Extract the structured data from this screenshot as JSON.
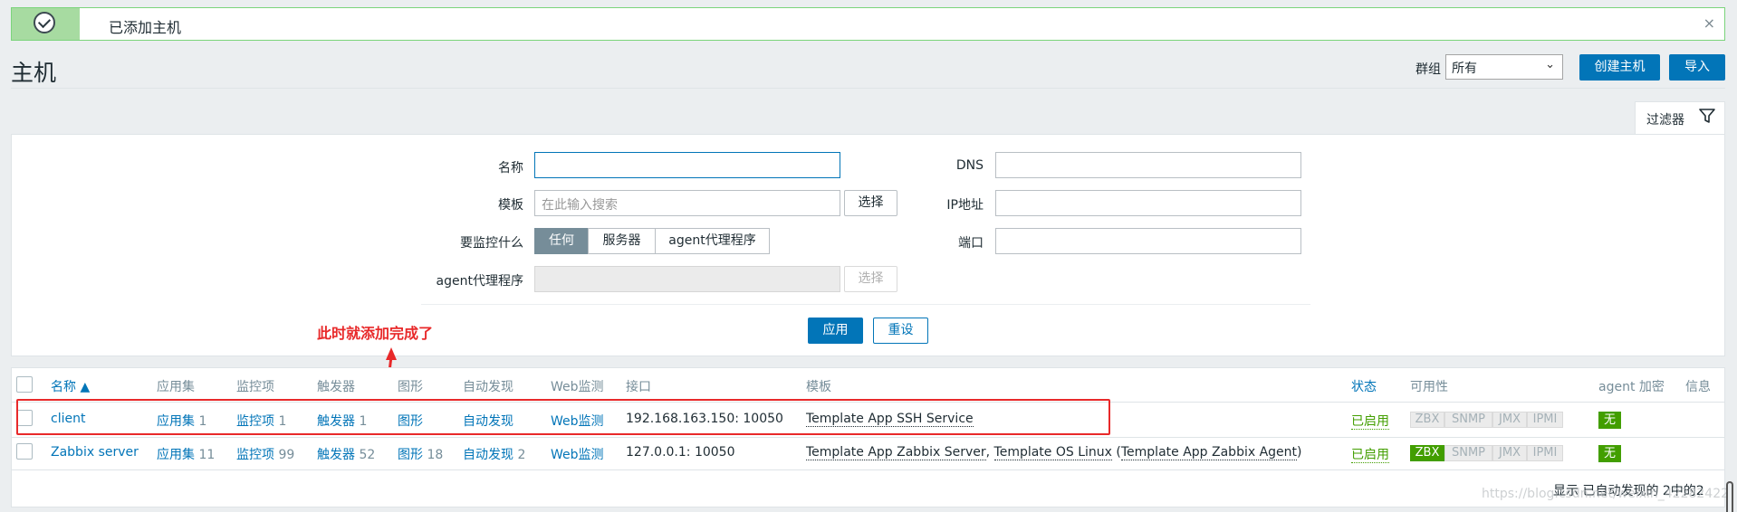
{
  "banner": {
    "message": "已添加主机",
    "close": "×"
  },
  "header": {
    "title": "主机",
    "group_label": "群组",
    "group_value": "所有",
    "create_host": "创建主机",
    "import": "导入"
  },
  "filter": {
    "tab_label": "过滤器",
    "name_label": "名称",
    "template_label": "模板",
    "template_placeholder": "在此输入搜索",
    "template_select": "选择",
    "monitored_by_label": "要监控什么",
    "monitored_by_options": [
      "任何",
      "服务器",
      "agent代理程序"
    ],
    "proxy_label": "agent代理程序",
    "proxy_select": "选择",
    "dns_label": "DNS",
    "ip_label": "IP地址",
    "port_label": "端口",
    "apply": "应用",
    "reset": "重设"
  },
  "annotation": "此时就添加完成了",
  "table": {
    "headers": {
      "name": "名称 ▲",
      "applications": "应用集",
      "items": "监控项",
      "triggers": "触发器",
      "graphs": "图形",
      "discovery": "自动发现",
      "web": "Web监测",
      "interface": "接口",
      "templates": "模板",
      "status": "状态",
      "availability": "可用性",
      "agent_encryption": "agent 加密",
      "info": "信息"
    },
    "rows": [
      {
        "name": "client",
        "applications": "应用集",
        "applications_count": "1",
        "items": "监控项",
        "items_count": "1",
        "triggers": "触发器",
        "triggers_count": "1",
        "graphs": "图形",
        "graphs_count": "",
        "discovery": "自动发现",
        "discovery_count": "",
        "web": "Web监测",
        "interface": "192.168.163.150: 10050",
        "template_1": "Template App SSH Service",
        "template_sep": "",
        "template_2": "",
        "template_3": "",
        "status": "已启用",
        "zbx": "ZBX",
        "snmp": "SNMP",
        "jmx": "JMX",
        "ipmi": "IPMI",
        "encryption": "无"
      },
      {
        "name": "Zabbix server",
        "applications": "应用集",
        "applications_count": "11",
        "items": "监控项",
        "items_count": "99",
        "triggers": "触发器",
        "triggers_count": "52",
        "graphs": "图形",
        "graphs_count": "18",
        "discovery": "自动发现",
        "discovery_count": "2",
        "web": "Web监测",
        "interface": "127.0.0.1: 10050",
        "template_1": "Template App Zabbix Server",
        "template_sep": ", ",
        "template_2": "Template OS Linux",
        "template_3": "Template App Zabbix Agent",
        "status": "已启用",
        "zbx": "ZBX",
        "snmp": "SNMP",
        "jmx": "JMX",
        "ipmi": "IPMI",
        "encryption": "无"
      }
    ],
    "footer": "显示 已自动发现的 2中的2"
  },
  "watermark": "https://blog.csdn.net/weixin_42282422",
  "colors": {
    "accent": "#0275b8",
    "enabled": "#429e00",
    "annotation": "#e8292a",
    "banner_border": "#7bd47b"
  }
}
